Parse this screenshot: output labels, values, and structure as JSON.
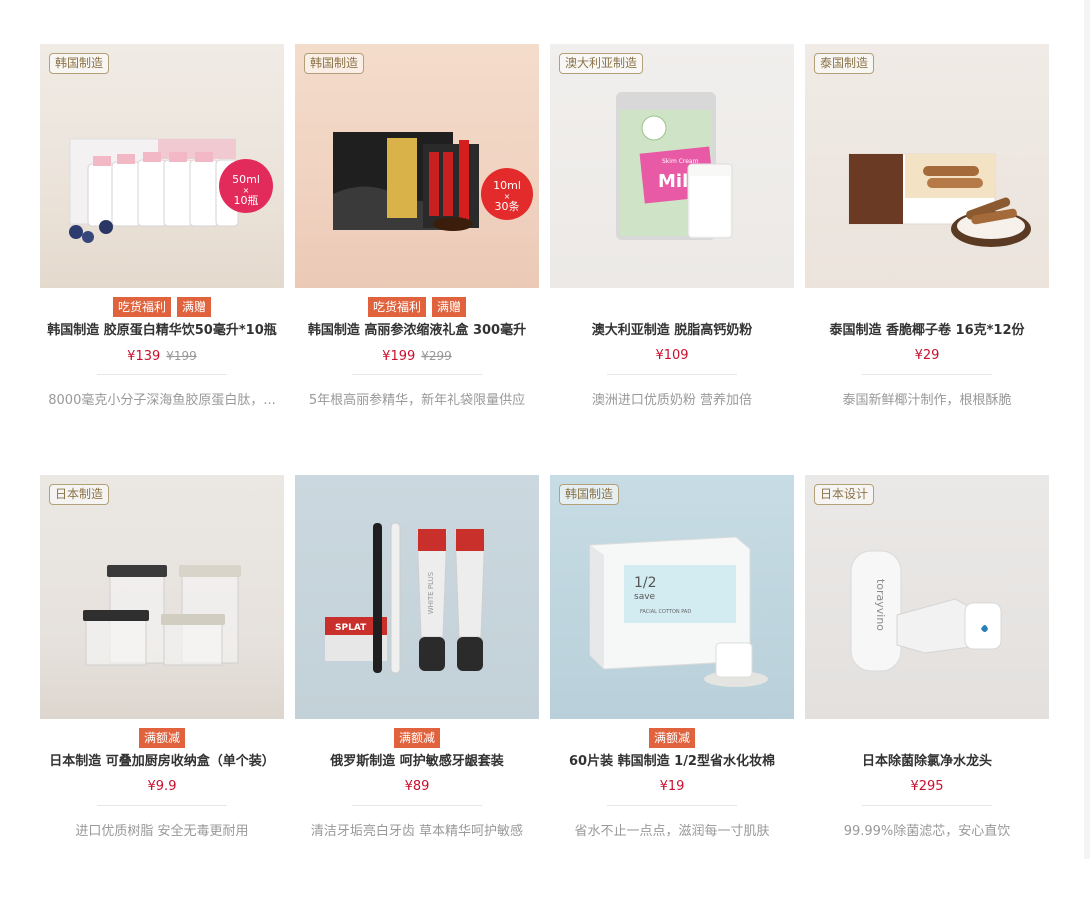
{
  "products": [
    {
      "origin": "韩国制造",
      "badges": [
        "吃货福利",
        "满赠"
      ],
      "name": "韩国制造 胶原蛋白精华饮50毫升*10瓶",
      "price": "¥139",
      "old_price": "¥199",
      "desc": "8000毫克小分子深海鱼胶原蛋白肽，...",
      "image_text": [
        "50ml",
        "×",
        "10瓶"
      ],
      "bg": "#ece6df"
    },
    {
      "origin": "韩国制造",
      "badges": [
        "吃货福利",
        "满赠"
      ],
      "name": "韩国制造 高丽参浓缩液礼盒 300毫升",
      "price": "¥199",
      "old_price": "¥299",
      "desc": "5年根高丽参精华，新年礼袋限量供应",
      "image_text": [
        "10ml",
        "×",
        "30条"
      ],
      "bg": "#f2ddd0"
    },
    {
      "origin": "澳大利亚制造",
      "badges": [],
      "name": "澳大利亚制造 脱脂高钙奶粉",
      "price": "¥109",
      "old_price": "",
      "desc": "澳洲进口优质奶粉 营养加倍",
      "image_text": [
        "Skim Cream",
        "Milk"
      ],
      "bg": "#efedeb"
    },
    {
      "origin": "泰国制造",
      "badges": [],
      "name": "泰国制造 香脆椰子卷 16克*12份",
      "price": "¥29",
      "old_price": "",
      "desc": "泰国新鲜椰汁制作，根根酥脆",
      "image_text": [],
      "bg": "#eee7e1"
    },
    {
      "origin": "日本制造",
      "badges": [
        "满额减"
      ],
      "name": "日本制造 可叠加厨房收纳盒（单个装）",
      "price": "¥9.9",
      "old_price": "",
      "desc": "进口优质树脂 安全无毒更耐用",
      "image_text": [],
      "bg": "#e9e6e2"
    },
    {
      "origin": "",
      "badges": [
        "满额减"
      ],
      "name": "俄罗斯制造 呵护敏感牙龈套装",
      "price": "¥89",
      "old_price": "",
      "desc": "清洁牙垢亮白牙齿 草本精华呵护敏感",
      "image_text": [
        "SPLAT",
        "WHITE PLUS"
      ],
      "bg": "#c9d6dd"
    },
    {
      "origin": "韩国制造",
      "badges": [
        "满额减"
      ],
      "name": "60片装 韩国制造 1/2型省水化妆棉",
      "price": "¥19",
      "old_price": "",
      "desc": "省水不止一点点，滋润每一寸肌肤",
      "image_text": [
        "1/2",
        "save",
        "FACIAL COTTON PAD"
      ],
      "bg": "#bcd3dc"
    },
    {
      "origin": "日本设计",
      "badges": [],
      "name": "日本除菌除氯净水龙头",
      "price": "¥295",
      "old_price": "",
      "desc": "99.99%除菌滤芯，安心直饮",
      "image_text": [
        "torayvino"
      ],
      "bg": "#e6e4e2"
    }
  ],
  "colors": {
    "badge": "#e0633e",
    "price": "#c8102e",
    "origin_border": "#b4a078"
  }
}
